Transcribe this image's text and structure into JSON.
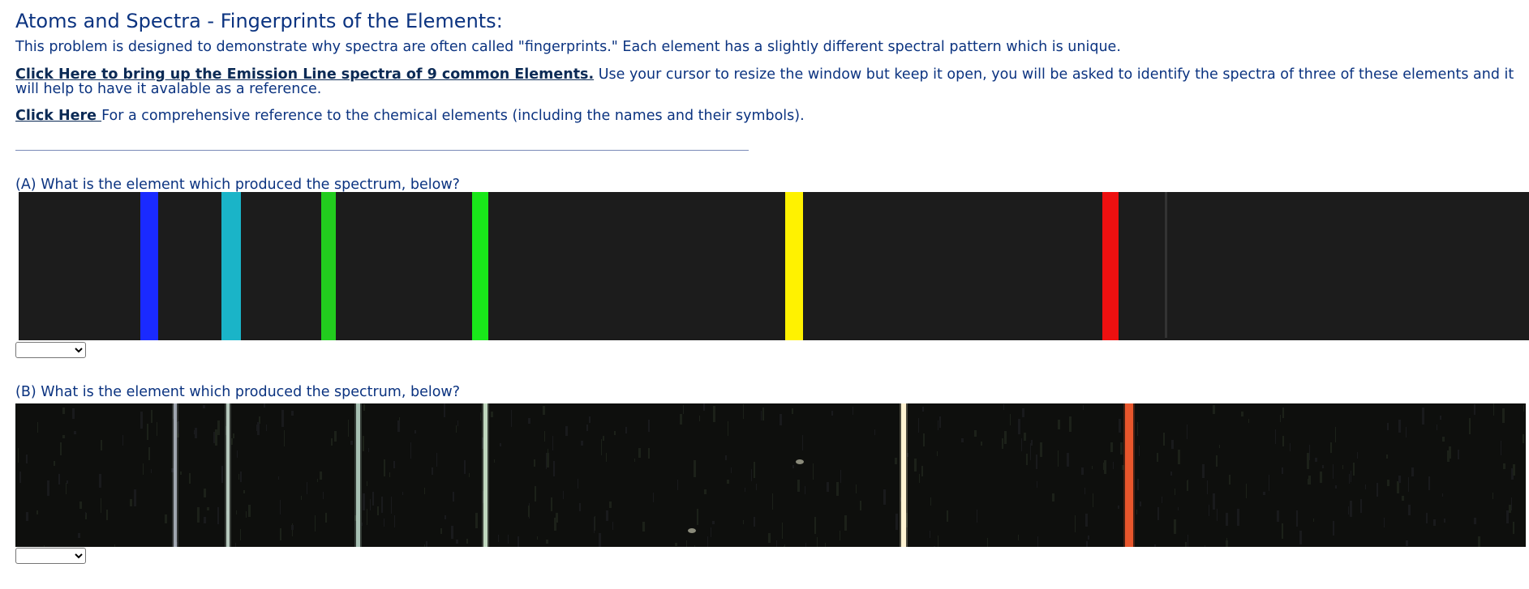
{
  "page": {
    "title": "Atoms and Spectra - Fingerprints of the Elements:",
    "intro": "This problem is designed to demonstrate why spectra are often called \"fingerprints.\" Each element has a slightly different spectral pattern which is unique.",
    "emission_link_label": "Click Here to bring up the Emission Line spectra of 9 common Elements.",
    "emission_link_trailing": " Use your cursor to resize the window but keep it open, you will be asked to identify the spectra of three of these elements and it will help to have it avalable as a reference.",
    "reference_link_label": "Click Here ",
    "reference_link_trailing": "For a comprehensive reference to the chemical elements (including the names and their symbols)."
  },
  "questions": [
    {
      "prompt": "(A) What is the element which produced the spectrum, below?",
      "selected": "",
      "spectrum_background": "#1c1c1c",
      "lines": [
        {
          "color": "#1a2aff",
          "intensity": 1.0
        },
        {
          "color": "#1ab4c8",
          "intensity": 1.0
        },
        {
          "color": "#22cc1e",
          "intensity": 1.0
        },
        {
          "color": "#19e81a",
          "intensity": 1.0
        },
        {
          "color": "#fff200",
          "intensity": 1.0
        },
        {
          "color": "#ee1010",
          "intensity": 1.0
        }
      ]
    },
    {
      "prompt": "(B) What is the element which produced the spectrum, below?",
      "selected": "",
      "spectrum_background": "#0e0f0d",
      "lines": [
        {
          "color": "#cfd6e2",
          "intensity": 0.7
        },
        {
          "color": "#d7ecdf",
          "intensity": 0.8
        },
        {
          "color": "#cfeedd",
          "intensity": 0.75
        },
        {
          "color": "#d8f2d6",
          "intensity": 0.85
        },
        {
          "color": "#fff3d2",
          "intensity": 1.0
        },
        {
          "color": "#e8562c",
          "intensity": 1.0
        }
      ]
    }
  ]
}
